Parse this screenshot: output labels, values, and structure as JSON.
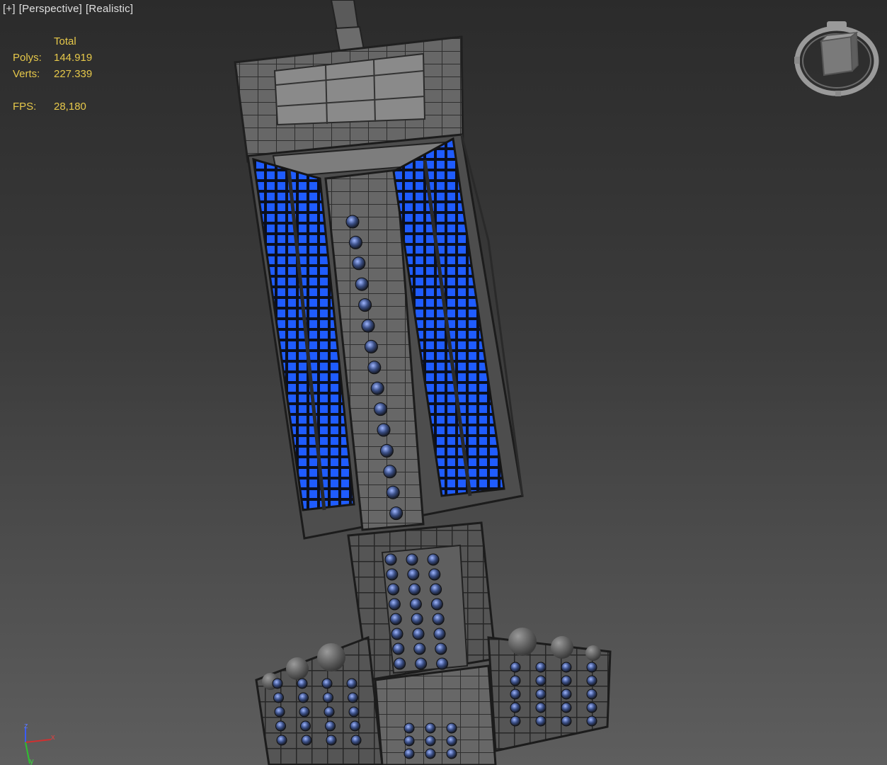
{
  "viewport": {
    "label_plus": "[+]",
    "label_view": "[Perspective]",
    "label_shading": "[Realistic]"
  },
  "stats": {
    "header": "Total",
    "polys_label": "Polys:",
    "polys_value": "144.919",
    "verts_label": "Verts:",
    "verts_value": "227.339",
    "fps_label": "FPS:",
    "fps_value": "28,180"
  },
  "colors": {
    "stats_text": "#e6c84a",
    "label_text": "#e0e0e0",
    "glow_blue": "#1e5cff",
    "hull_gray": "#6b6b6b"
  },
  "icons": {
    "viewcube": "viewcube-icon",
    "axis_tripod": "axis-tripod-icon"
  },
  "axis": {
    "z": "z",
    "x": "x",
    "y": "y"
  }
}
